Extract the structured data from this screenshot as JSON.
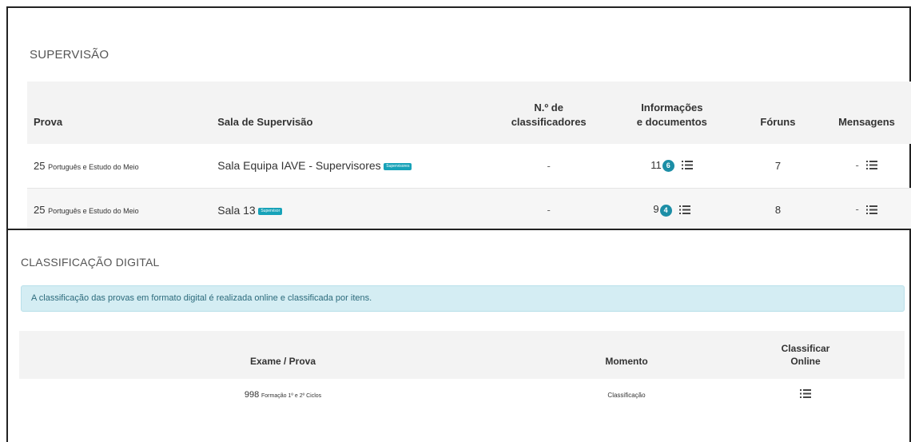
{
  "supervisao": {
    "title": "SUPERVISÃO",
    "headers": {
      "prova": "Prova",
      "sala": "Sala de Supervisão",
      "ncls_line1": "N.º de",
      "ncls_line2": "classificadores",
      "info_line1": "Informações",
      "info_line2": "e documentos",
      "foruns": "Fóruns",
      "mensagens": "Mensagens"
    },
    "rows": [
      {
        "prova_code": "25",
        "prova_name": "Português e Estudo do Meio",
        "sala": "Sala Equipa IAVE - Supervisores",
        "sala_badge": "Supervisores",
        "classificadores": "-",
        "info_count": "11",
        "info_badge": "6",
        "foruns": "7",
        "mensagens": "-"
      },
      {
        "prova_code": "25",
        "prova_name": "Português e Estudo do Meio",
        "sala": "Sala 13",
        "sala_badge": "Supervisor",
        "classificadores": "-",
        "info_count": "9",
        "info_badge": "4",
        "foruns": "8",
        "mensagens": "-"
      }
    ]
  },
  "classificacao": {
    "title": "CLASSIFICAÇÃO DIGITAL",
    "alert": "A classificação das provas em formato digital é realizada online e classificada por itens.",
    "headers": {
      "exame": "Exame / Prova",
      "momento": "Momento",
      "online_line1": "Classificar",
      "online_line2": "Online"
    },
    "rows": [
      {
        "exame_code": "998",
        "exame_name": "Formação 1º e 2º Ciclos",
        "momento": "Classificação"
      }
    ]
  },
  "colors": {
    "badge": "#17a2b8",
    "count_badge": "#1c8ea6",
    "alert_bg": "#d4edf3",
    "header_bg": "#f3f3f3"
  },
  "icons": [
    "list-icon"
  ]
}
